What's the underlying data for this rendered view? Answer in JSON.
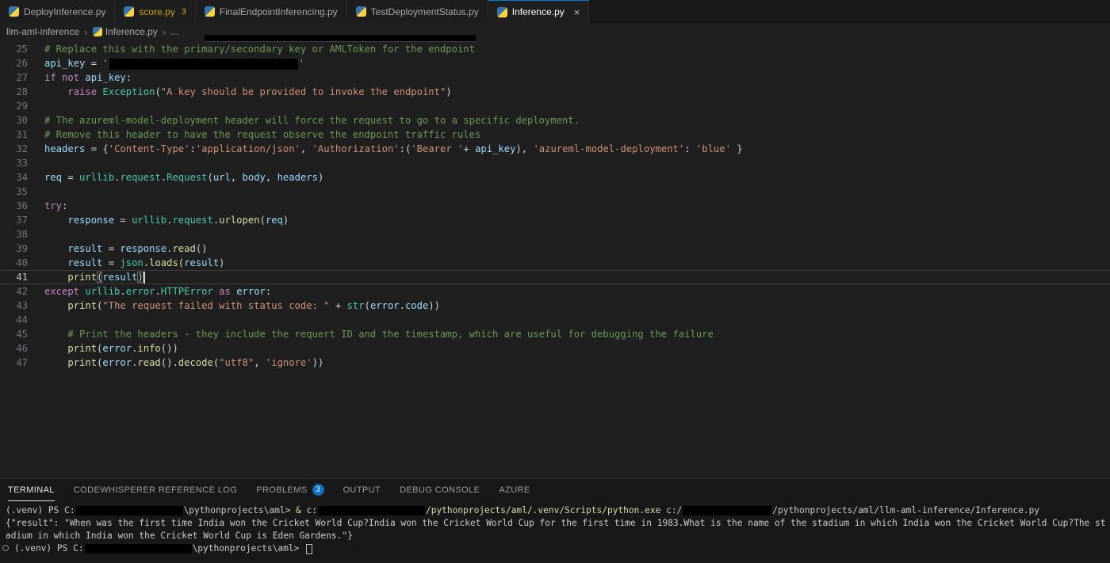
{
  "colors": {
    "editor_bg": "#1f1f1f",
    "panel_bg": "#181818",
    "accent_blue": "#0078d4",
    "warning_yellow": "#cca700",
    "badge_blue": "#0e70c0",
    "comment_green": "#6a9955",
    "keyword_purple": "#c586c0",
    "string_orange": "#ce9178",
    "redaction_black": "#000000"
  },
  "tabs": [
    {
      "label": "DeployInference.py"
    },
    {
      "label": "score.py",
      "badge": "3",
      "warn": true
    },
    {
      "label": "FinalEndpointInferencing.py"
    },
    {
      "label": "TestDeploymentStatus.py"
    },
    {
      "label": "Inference.py",
      "active": true,
      "close_label": "×"
    }
  ],
  "breadcrumb": {
    "items": [
      {
        "label": "llm-aml-inference"
      },
      {
        "label": "Inference.py",
        "icon": true
      },
      {
        "label": "..."
      }
    ]
  },
  "editor": {
    "lines": [
      {
        "n": 25,
        "tok": [
          {
            "c": "c",
            "t": "# Replace this with the primary/secondary key or AMLToken for the endpoint"
          }
        ]
      },
      {
        "n": 26,
        "tok": [
          {
            "c": "v",
            "t": "api_key"
          },
          {
            "c": "p",
            "t": " = "
          },
          {
            "c": "s",
            "t": "'"
          },
          {
            "r": 238
          },
          {
            "c": "s",
            "t": "'"
          }
        ]
      },
      {
        "n": 27,
        "tok": [
          {
            "c": "k",
            "t": "if"
          },
          {
            "c": "p",
            "t": " "
          },
          {
            "c": "k",
            "t": "not"
          },
          {
            "c": "p",
            "t": " "
          },
          {
            "c": "v",
            "t": "api_key"
          },
          {
            "c": "p",
            "t": ":"
          }
        ]
      },
      {
        "n": 28,
        "tok": [
          {
            "c": "p",
            "t": "    "
          },
          {
            "c": "k",
            "t": "raise"
          },
          {
            "c": "p",
            "t": " "
          },
          {
            "c": "t",
            "t": "Exception"
          },
          {
            "c": "p",
            "t": "("
          },
          {
            "c": "s",
            "t": "\"A key should be provided to invoke the endpoint\""
          },
          {
            "c": "p",
            "t": ")"
          }
        ]
      },
      {
        "n": 29,
        "tok": []
      },
      {
        "n": 30,
        "tok": [
          {
            "c": "c",
            "t": "# The azureml-model-deployment header will force the request to go to a specific deployment."
          }
        ]
      },
      {
        "n": 31,
        "tok": [
          {
            "c": "c",
            "t": "# Remove this header to have the request observe the endpoint traffic rules"
          }
        ]
      },
      {
        "n": 32,
        "tok": [
          {
            "c": "v",
            "t": "headers"
          },
          {
            "c": "p",
            "t": " = {"
          },
          {
            "c": "s",
            "t": "'Content-Type'"
          },
          {
            "c": "p",
            "t": ":"
          },
          {
            "c": "s",
            "t": "'application/json'"
          },
          {
            "c": "p",
            "t": ", "
          },
          {
            "c": "s",
            "t": "'Authorization'"
          },
          {
            "c": "p",
            "t": ":("
          },
          {
            "c": "s",
            "t": "'Bearer '"
          },
          {
            "c": "p",
            "t": "+ "
          },
          {
            "c": "v",
            "t": "api_key"
          },
          {
            "c": "p",
            "t": "), "
          },
          {
            "c": "s",
            "t": "'azureml-model-deployment'"
          },
          {
            "c": "p",
            "t": ": "
          },
          {
            "c": "s",
            "t": "'blue'"
          },
          {
            "c": "p",
            "t": " }"
          }
        ]
      },
      {
        "n": 33,
        "tok": []
      },
      {
        "n": 34,
        "tok": [
          {
            "c": "v",
            "t": "req"
          },
          {
            "c": "p",
            "t": " = "
          },
          {
            "c": "t",
            "t": "urllib"
          },
          {
            "c": "p",
            "t": "."
          },
          {
            "c": "t",
            "t": "request"
          },
          {
            "c": "p",
            "t": "."
          },
          {
            "c": "t",
            "t": "Request"
          },
          {
            "c": "p",
            "t": "("
          },
          {
            "c": "v",
            "t": "url"
          },
          {
            "c": "p",
            "t": ", "
          },
          {
            "c": "v",
            "t": "body"
          },
          {
            "c": "p",
            "t": ", "
          },
          {
            "c": "v",
            "t": "headers"
          },
          {
            "c": "p",
            "t": ")"
          }
        ]
      },
      {
        "n": 35,
        "tok": []
      },
      {
        "n": 36,
        "tok": [
          {
            "c": "k",
            "t": "try"
          },
          {
            "c": "p",
            "t": ":"
          }
        ]
      },
      {
        "n": 37,
        "tok": [
          {
            "c": "p",
            "t": "    "
          },
          {
            "c": "v",
            "t": "response"
          },
          {
            "c": "p",
            "t": " = "
          },
          {
            "c": "t",
            "t": "urllib"
          },
          {
            "c": "p",
            "t": "."
          },
          {
            "c": "t",
            "t": "request"
          },
          {
            "c": "p",
            "t": "."
          },
          {
            "c": "f",
            "t": "urlopen"
          },
          {
            "c": "p",
            "t": "("
          },
          {
            "c": "v",
            "t": "req"
          },
          {
            "c": "p",
            "t": ")"
          }
        ]
      },
      {
        "n": 38,
        "tok": []
      },
      {
        "n": 39,
        "tok": [
          {
            "c": "p",
            "t": "    "
          },
          {
            "c": "v",
            "t": "result"
          },
          {
            "c": "p",
            "t": " = "
          },
          {
            "c": "v",
            "t": "response"
          },
          {
            "c": "p",
            "t": "."
          },
          {
            "c": "f",
            "t": "read"
          },
          {
            "c": "p",
            "t": "()"
          }
        ]
      },
      {
        "n": 40,
        "tok": [
          {
            "c": "p",
            "t": "    "
          },
          {
            "c": "v",
            "t": "result"
          },
          {
            "c": "p",
            "t": " = "
          },
          {
            "c": "t",
            "t": "json"
          },
          {
            "c": "p",
            "t": "."
          },
          {
            "c": "f",
            "t": "loads"
          },
          {
            "c": "p",
            "t": "("
          },
          {
            "c": "v",
            "t": "result"
          },
          {
            "c": "p",
            "t": ")"
          }
        ]
      },
      {
        "n": 41,
        "active": true,
        "tok": [
          {
            "c": "p",
            "t": "    "
          },
          {
            "c": "f",
            "t": "print"
          },
          {
            "c": "p",
            "t": "(",
            "b": true
          },
          {
            "c": "v",
            "t": "result"
          },
          {
            "c": "p",
            "t": ")",
            "b": true
          },
          {
            "cur": true
          }
        ]
      },
      {
        "n": 42,
        "tok": [
          {
            "c": "k",
            "t": "except"
          },
          {
            "c": "p",
            "t": " "
          },
          {
            "c": "t",
            "t": "urllib"
          },
          {
            "c": "p",
            "t": "."
          },
          {
            "c": "t",
            "t": "error"
          },
          {
            "c": "p",
            "t": "."
          },
          {
            "c": "t",
            "t": "HTTPError"
          },
          {
            "c": "p",
            "t": " "
          },
          {
            "c": "k",
            "t": "as"
          },
          {
            "c": "p",
            "t": " "
          },
          {
            "c": "v",
            "t": "error"
          },
          {
            "c": "p",
            "t": ":"
          }
        ]
      },
      {
        "n": 43,
        "tok": [
          {
            "c": "p",
            "t": "    "
          },
          {
            "c": "f",
            "t": "print"
          },
          {
            "c": "p",
            "t": "("
          },
          {
            "c": "s",
            "t": "\"The request failed with status code: \""
          },
          {
            "c": "p",
            "t": " + "
          },
          {
            "c": "t",
            "t": "str"
          },
          {
            "c": "p",
            "t": "("
          },
          {
            "c": "v",
            "t": "error"
          },
          {
            "c": "p",
            "t": "."
          },
          {
            "c": "v",
            "t": "code"
          },
          {
            "c": "p",
            "t": "))"
          }
        ]
      },
      {
        "n": 44,
        "tok": []
      },
      {
        "n": 45,
        "tok": [
          {
            "c": "p",
            "t": "    "
          },
          {
            "c": "c",
            "t": "# Print the headers - they include the requert ID and the timestamp, which are useful for debugging the failure"
          }
        ]
      },
      {
        "n": 46,
        "tok": [
          {
            "c": "p",
            "t": "    "
          },
          {
            "c": "f",
            "t": "print"
          },
          {
            "c": "p",
            "t": "("
          },
          {
            "c": "v",
            "t": "error"
          },
          {
            "c": "p",
            "t": "."
          },
          {
            "c": "f",
            "t": "info"
          },
          {
            "c": "p",
            "t": "())"
          }
        ]
      },
      {
        "n": 47,
        "tok": [
          {
            "c": "p",
            "t": "    "
          },
          {
            "c": "f",
            "t": "print"
          },
          {
            "c": "p",
            "t": "("
          },
          {
            "c": "v",
            "t": "error"
          },
          {
            "c": "p",
            "t": "."
          },
          {
            "c": "f",
            "t": "read"
          },
          {
            "c": "p",
            "t": "()."
          },
          {
            "c": "f",
            "t": "decode"
          },
          {
            "c": "p",
            "t": "("
          },
          {
            "c": "s",
            "t": "\"utf8\""
          },
          {
            "c": "p",
            "t": ", "
          },
          {
            "c": "s",
            "t": "'ignore'"
          },
          {
            "c": "p",
            "t": "))"
          }
        ]
      }
    ]
  },
  "panel": {
    "tabs": [
      {
        "label": "TERMINAL",
        "active": true
      },
      {
        "label": "CODEWHISPERER REFERENCE LOG"
      },
      {
        "label": "PROBLEMS",
        "badge": "3"
      },
      {
        "label": "OUTPUT"
      },
      {
        "label": "DEBUG CONSOLE"
      },
      {
        "label": "AZURE"
      }
    ]
  },
  "terminal": {
    "lines": [
      {
        "seg": [
          {
            "t": "(.venv) PS C:"
          },
          {
            "r": 135
          },
          {
            "t": "\\pythonprojects\\aml> "
          },
          {
            "t": "& c:",
            "c": "y"
          },
          {
            "r": 135
          },
          {
            "t": "/pythonprojects/aml/.venv/Scripts/python.exe",
            "c": "y"
          },
          {
            "t": " c:/"
          },
          {
            "r": 112
          },
          {
            "t": "/pythonprojects/aml/llm-aml-inference/Inference.py"
          }
        ]
      },
      {
        "seg": [
          {
            "t": "{\"result\": \"When was the first time India won the Cricket World Cup?India won the Cricket World Cup for the first time in 1983.What is the name of the stadium in which India won the Cricket World Cup?The stadium in which India won the Cricket World Cup is Eden Gardens.\"}"
          }
        ]
      },
      {
        "indent": true,
        "seg": [
          {
            "t": "(.venv) PS C:"
          },
          {
            "r": 135
          },
          {
            "t": "\\pythonprojects\\aml> "
          },
          {
            "cur": true
          }
        ]
      }
    ]
  }
}
